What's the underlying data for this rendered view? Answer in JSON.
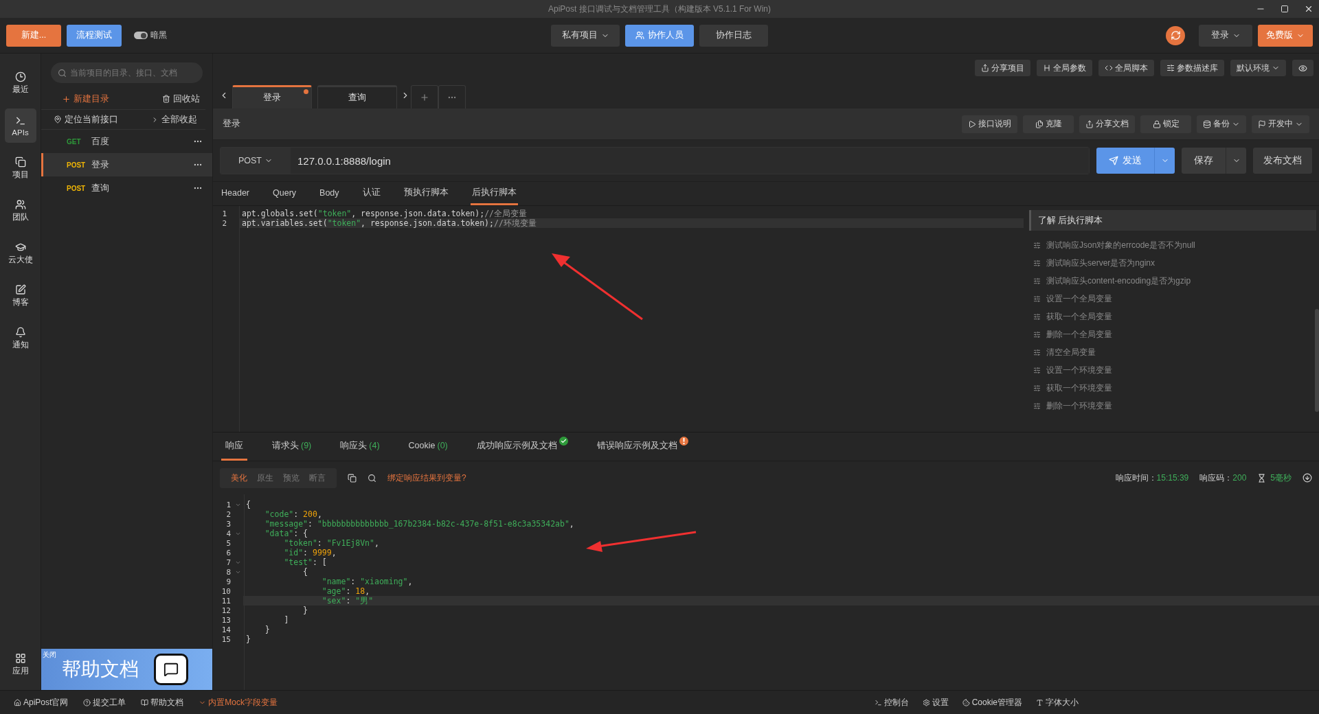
{
  "window": {
    "title": "ApiPost 接口调试与文档管理工具（构建版本 V5.1.1 For Win)"
  },
  "toolbar": {
    "new_button": "新建...",
    "flow_button": "流程测试",
    "dark_mode": {
      "label": "暗黑",
      "on": true
    },
    "center_buttons": [
      {
        "label": "私有项目",
        "selected": false,
        "dropdown": true
      },
      {
        "label": "协作人员",
        "selected": true,
        "dropdown": false
      },
      {
        "label": "协作日志",
        "selected": false,
        "dropdown": false
      }
    ],
    "login": "登录",
    "plan": "免费版"
  },
  "rail": [
    {
      "label": "最近",
      "selected": false
    },
    {
      "label": "APIs",
      "selected": true
    },
    {
      "label": "项目",
      "selected": false
    },
    {
      "label": "团队",
      "selected": false
    },
    {
      "label": "云大使",
      "selected": false
    },
    {
      "label": "博客",
      "selected": false
    },
    {
      "label": "通知",
      "selected": false
    }
  ],
  "rail_bottom": {
    "label": "应用"
  },
  "sidebar": {
    "search_placeholder": "当前项目的目录、接口、文档",
    "new_folder": "新建目录",
    "trash": "回收站",
    "locate": "定位当前接口",
    "collapse_all": "全部收起",
    "items": [
      {
        "method": "GET",
        "color": "#2e9a3a",
        "name": "百度",
        "selected": false
      },
      {
        "method": "POST",
        "color": "#f2b705",
        "name": "登录",
        "selected": true
      },
      {
        "method": "POST",
        "color": "#f2b705",
        "name": "查询",
        "selected": false
      }
    ],
    "banner": {
      "close": "关闭",
      "title": "帮助文档"
    }
  },
  "project_toolbar": [
    {
      "label": "分享项目",
      "dropdown": false
    },
    {
      "label": "全局参数",
      "dropdown": false
    },
    {
      "label": "全局脚本",
      "dropdown": false
    },
    {
      "label": "参数描述库",
      "dropdown": false
    },
    {
      "label": "默认环境",
      "dropdown": true
    }
  ],
  "tabs": [
    {
      "label": "登录",
      "selected": true,
      "modified": true
    },
    {
      "label": "查询",
      "selected": false,
      "modified": false
    }
  ],
  "request": {
    "title": "登录",
    "actions": [
      {
        "label": "接口说明",
        "dropdown": false
      },
      {
        "label": "克隆",
        "dropdown": false
      },
      {
        "label": "分享文档",
        "dropdown": false
      },
      {
        "label": "锁定",
        "dropdown": false
      },
      {
        "label": "备份",
        "dropdown": true
      },
      {
        "label": "开发中",
        "dropdown": true
      }
    ],
    "method": "POST",
    "url": "127.0.0.1:8888/login",
    "send": "发送",
    "save": "保存",
    "publish": "发布文档"
  },
  "request_tabs": [
    {
      "label": "Header",
      "selected": false
    },
    {
      "label": "Query",
      "selected": false
    },
    {
      "label": "Body",
      "selected": false
    },
    {
      "label": "认证",
      "selected": false
    },
    {
      "label": "预执行脚本",
      "selected": false
    },
    {
      "label": "后执行脚本",
      "selected": true
    }
  ],
  "script": {
    "lines": [
      {
        "number": "1",
        "current": false,
        "foldable": false,
        "tokens": [
          {
            "kind": "p",
            "text": "apt.globals.set("
          },
          {
            "kind": "s",
            "text": "\"token\""
          },
          {
            "kind": "p",
            "text": ", response.json.data.token);"
          },
          {
            "kind": "c",
            "text": "//全局变量"
          }
        ]
      },
      {
        "number": "2",
        "current": true,
        "foldable": false,
        "tokens": [
          {
            "kind": "p",
            "text": "apt.variables.set("
          },
          {
            "kind": "s",
            "text": "\"token\""
          },
          {
            "kind": "p",
            "text": ", response.json.data.token);"
          },
          {
            "kind": "c",
            "text": "//环境变量"
          }
        ]
      }
    ]
  },
  "snippets": {
    "title": "了解 后执行脚本",
    "items": [
      "测试响应Json对象的errcode是否不为null",
      "测试响应头server是否为nginx",
      "测试响应头content-encoding是否为gzip",
      "设置一个全局变量",
      "获取一个全局变量",
      "删除一个全局变量",
      "清空全局变量",
      "设置一个环境变量",
      "获取一个环境变量",
      "删除一个环境变量"
    ]
  },
  "response": {
    "tabs": [
      {
        "label": "响应",
        "kind": "plain",
        "selected": true
      },
      {
        "label": "请求头",
        "count": "(9)",
        "kind": "plain",
        "selected": false
      },
      {
        "label": "响应头",
        "count": "(4)",
        "kind": "plain",
        "selected": false
      },
      {
        "label": "Cookie",
        "count": "(0)",
        "kind": "plain",
        "selected": false
      },
      {
        "label": "成功响应示例及文档",
        "kind": "success",
        "selected": false
      },
      {
        "label": "错误响应示例及文档",
        "kind": "error",
        "selected": false
      }
    ],
    "view_modes": [
      {
        "label": "美化",
        "selected": true
      },
      {
        "label": "原生",
        "selected": false
      },
      {
        "label": "预览",
        "selected": false
      },
      {
        "label": "断言",
        "selected": false
      }
    ],
    "bind_link": "绑定响应结果到变量?",
    "time_label": "响应时间：",
    "time": "15:15:39",
    "code_label": "响应码：",
    "code": "200",
    "duration": "5毫秒",
    "body_lines": [
      {
        "number": "1",
        "current": false,
        "foldable": true,
        "tokens": [
          {
            "kind": "p",
            "text": "{"
          }
        ]
      },
      {
        "number": "2",
        "current": false,
        "foldable": false,
        "tokens": [
          {
            "kind": "k",
            "text": "    \"code\""
          },
          {
            "kind": "p",
            "text": ": "
          },
          {
            "kind": "n",
            "text": "200"
          },
          {
            "kind": "p",
            "text": ","
          }
        ]
      },
      {
        "number": "3",
        "current": false,
        "foldable": false,
        "tokens": [
          {
            "kind": "k",
            "text": "    \"message\""
          },
          {
            "kind": "p",
            "text": ": "
          },
          {
            "kind": "s",
            "text": "\"bbbbbbbbbbbbbb_167b2384-b82c-437e-8f51-e8c3a35342ab\""
          },
          {
            "kind": "p",
            "text": ","
          }
        ]
      },
      {
        "number": "4",
        "current": false,
        "foldable": true,
        "tokens": [
          {
            "kind": "k",
            "text": "    \"data\""
          },
          {
            "kind": "p",
            "text": ": {"
          }
        ]
      },
      {
        "number": "5",
        "current": false,
        "foldable": false,
        "tokens": [
          {
            "kind": "k",
            "text": "        \"token\""
          },
          {
            "kind": "p",
            "text": ": "
          },
          {
            "kind": "s",
            "text": "\"Fv1Ej8Vn\""
          },
          {
            "kind": "p",
            "text": ","
          }
        ]
      },
      {
        "number": "6",
        "current": false,
        "foldable": false,
        "tokens": [
          {
            "kind": "k",
            "text": "        \"id\""
          },
          {
            "kind": "p",
            "text": ": "
          },
          {
            "kind": "n",
            "text": "9999"
          },
          {
            "kind": "p",
            "text": ","
          }
        ]
      },
      {
        "number": "7",
        "current": false,
        "foldable": true,
        "tokens": [
          {
            "kind": "k",
            "text": "        \"test\""
          },
          {
            "kind": "p",
            "text": ": ["
          }
        ]
      },
      {
        "number": "8",
        "current": false,
        "foldable": true,
        "tokens": [
          {
            "kind": "p",
            "text": "            {"
          }
        ]
      },
      {
        "number": "9",
        "current": false,
        "foldable": false,
        "tokens": [
          {
            "kind": "k",
            "text": "                \"name\""
          },
          {
            "kind": "p",
            "text": ": "
          },
          {
            "kind": "s",
            "text": "\"xiaoming\""
          },
          {
            "kind": "p",
            "text": ","
          }
        ]
      },
      {
        "number": "10",
        "current": false,
        "foldable": false,
        "tokens": [
          {
            "kind": "k",
            "text": "                \"age\""
          },
          {
            "kind": "p",
            "text": ": "
          },
          {
            "kind": "n",
            "text": "18"
          },
          {
            "kind": "p",
            "text": ","
          }
        ]
      },
      {
        "number": "11",
        "current": true,
        "foldable": false,
        "tokens": [
          {
            "kind": "k",
            "text": "                \"sex\""
          },
          {
            "kind": "p",
            "text": ": "
          },
          {
            "kind": "s",
            "text": "\"男\""
          }
        ]
      },
      {
        "number": "12",
        "current": false,
        "foldable": false,
        "tokens": [
          {
            "kind": "p",
            "text": "            }"
          }
        ]
      },
      {
        "number": "13",
        "current": false,
        "foldable": false,
        "tokens": [
          {
            "kind": "p",
            "text": "        ]"
          }
        ]
      },
      {
        "number": "14",
        "current": false,
        "foldable": false,
        "tokens": [
          {
            "kind": "p",
            "text": "    }"
          }
        ]
      },
      {
        "number": "15",
        "current": false,
        "foldable": false,
        "tokens": [
          {
            "kind": "p",
            "text": "}"
          }
        ]
      }
    ]
  },
  "status_bar": {
    "left": [
      {
        "label": "ApiPost官网",
        "highlight": false
      },
      {
        "label": "提交工单",
        "highlight": false
      },
      {
        "label": "帮助文档",
        "highlight": false
      },
      {
        "label": "内置Mock字段变量",
        "highlight": true
      }
    ],
    "right": [
      "控制台",
      "设置",
      "Cookie管理器",
      "字体大小"
    ]
  }
}
